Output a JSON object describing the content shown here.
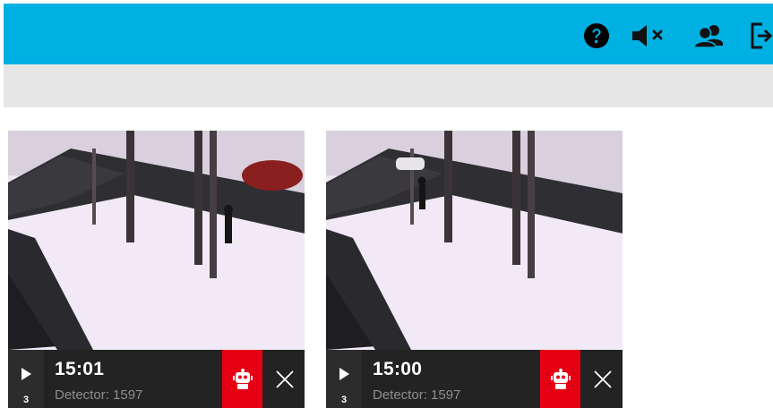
{
  "header": {
    "accent_color": "#00b0e2",
    "icons": [
      "help-icon",
      "mute-icon",
      "users-icon",
      "logout-icon"
    ]
  },
  "cards": [
    {
      "time": "15:01",
      "detector": "Detector: 1597",
      "play_count": "3",
      "alert_color": "#e60014"
    },
    {
      "time": "15:00",
      "detector": "Detector: 1597",
      "play_count": "3",
      "alert_color": "#e60014"
    }
  ]
}
